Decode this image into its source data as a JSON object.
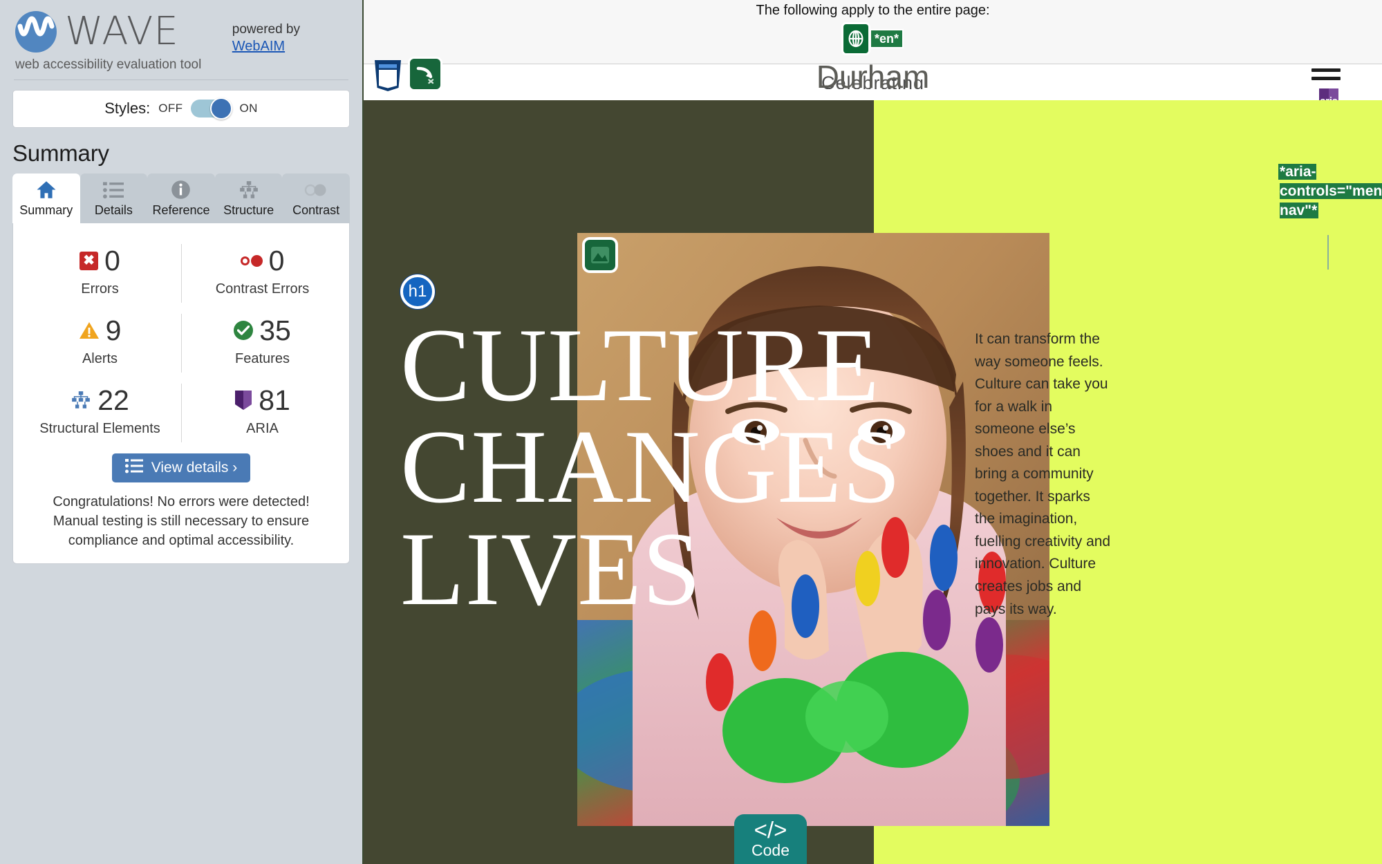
{
  "sidebar": {
    "brand": {
      "name": "WAVE",
      "tagline": "web accessibility evaluation tool",
      "powered_label": "powered by",
      "powered_link": "WebAIM",
      "logo_icon": "wave-logo-icon"
    },
    "styles": {
      "label": "Styles:",
      "off_label": "OFF",
      "on_label": "ON",
      "state": "ON"
    },
    "summary_title": "Summary",
    "tabs": [
      {
        "label": "Summary",
        "icon": "home-icon",
        "active": true
      },
      {
        "label": "Details",
        "icon": "list-icon",
        "active": false
      },
      {
        "label": "Reference",
        "icon": "info-icon",
        "active": false
      },
      {
        "label": "Structure",
        "icon": "structure-icon",
        "active": false
      },
      {
        "label": "Contrast",
        "icon": "contrast-icon",
        "active": false
      }
    ],
    "stats": [
      {
        "value": "0",
        "label": "Errors",
        "icon": "error-icon",
        "color": "#c62828"
      },
      {
        "value": "0",
        "label": "Contrast Errors",
        "icon": "contrast-icon",
        "color": "#c62828"
      },
      {
        "value": "9",
        "label": "Alerts",
        "icon": "alert-icon",
        "color": "#f0a41e"
      },
      {
        "value": "35",
        "label": "Features",
        "icon": "feature-icon",
        "color": "#2e8540"
      },
      {
        "value": "22",
        "label": "Structural Elements",
        "icon": "structure-icon",
        "color": "#4a7ab5"
      },
      {
        "value": "81",
        "label": "ARIA",
        "icon": "aria-icon",
        "color": "#5d2d7e"
      }
    ],
    "view_details_label": "View details ›",
    "view_details_icon": "list-icon",
    "congrats": "Congratulations! No errors were detected! Manual testing is still necessary to ensure compliance and optimal accessibility."
  },
  "preview": {
    "page_banner": {
      "text": "The following apply to the entire page:",
      "globe_icon": "language-globe-icon",
      "lang_label": "*en*"
    },
    "header": {
      "html5_icon": "html5-structure-icon",
      "skip_link_icon": "broken-skip-link-icon",
      "redundant_icon": "redundant-link-icon",
      "logo_subtext": "Celebrating",
      "logo_name": "Durham",
      "menu_icon": "hamburger-menu-icon",
      "aria_badge_label": "aria",
      "aria_annotation": "*aria-controls=\"menu-nav\"*"
    },
    "hero": {
      "h1_badge": "h1",
      "heading": "CULTURE\nCHANGES\nLIVES",
      "image_badge_icon": "image-icon",
      "body": "It can transform the way someone feels. Culture can take you for a walk in someone else’s shoes and it can bring a community together. It sparks the imagination, fuelling creativity and innovation. Culture creates jobs and pays its way.",
      "code_button": {
        "label": "Code",
        "glyph": "</>",
        "icon": "code-icon"
      }
    }
  },
  "colors": {
    "sidebar_bg": "#d1d7dd",
    "accent_blue": "#4a7ab5",
    "olive": "#444731",
    "lime": "#e3fc5f",
    "wave_green": "#17663b",
    "aria_purple": "#5d2d7e",
    "code_teal": "#17807c"
  }
}
